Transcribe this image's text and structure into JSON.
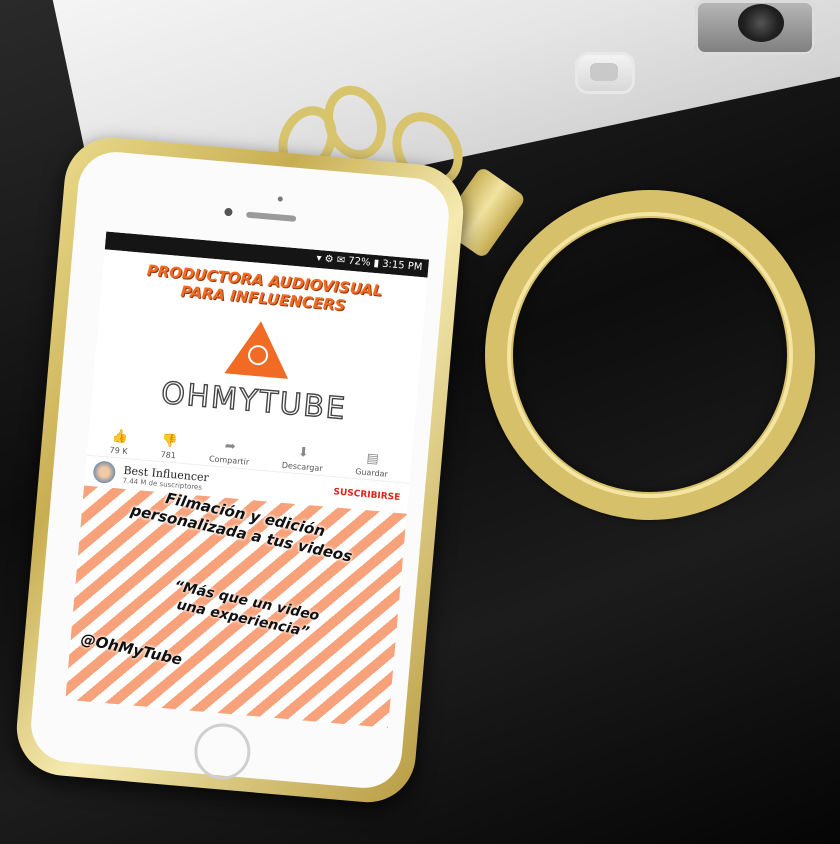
{
  "screen": {
    "status_bar": "▾ ⚙ ✉ 72% ▮ 3:15 PM",
    "headline_line1": "PRODUCTORA AUDIOVISUAL",
    "headline_line2": "PARA INFLUENCERS",
    "brand": "OHMYTUBE",
    "actions": [
      {
        "icon": "thumb-up-icon",
        "glyph": "👍",
        "label": "79 K"
      },
      {
        "icon": "thumb-down-icon",
        "glyph": "👎",
        "label": "781"
      },
      {
        "icon": "share-icon",
        "glyph": "➦",
        "label": "Compartir"
      },
      {
        "icon": "download-icon",
        "glyph": "⬇",
        "label": "Descargar"
      },
      {
        "icon": "save-icon",
        "glyph": "▤",
        "label": "Guardar"
      }
    ],
    "channel": {
      "name": "Best Influencer",
      "subscribers": "7.44 M de suscriptores",
      "subscribe": "SUSCRIBIRSE"
    },
    "promo": {
      "line1": "Filmación y edición",
      "line2": "personalizada a tus videos",
      "quote1": "“Más que un video",
      "quote2": "una experiencia”",
      "handle": "@OhMyTube"
    }
  },
  "colors": {
    "accent": "#f26b25",
    "subscribe": "#e0251b",
    "gold": "#d7c06a"
  }
}
